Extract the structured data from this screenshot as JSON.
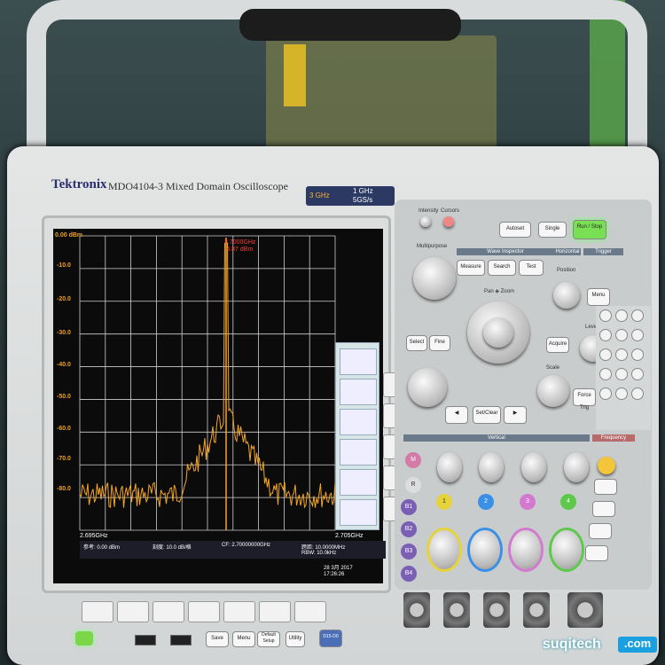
{
  "scene": {
    "brand": "Tektronix",
    "model": "MDO4104-3",
    "model_desc": "Mixed Domain Oscilloscope",
    "badge": {
      "freq": "3 GHz",
      "bw": "1 GHz",
      "sr": "5GS/s"
    }
  },
  "screen": {
    "ref_level": "0.00 dBm",
    "y_labels": [
      "-10.0",
      "-20.0",
      "-30.0",
      "-40.0",
      "-50.0",
      "-60.0",
      "-70.0",
      "-80.0"
    ],
    "marker": {
      "freq": "2.7000GHz",
      "level": "-4.87 dBm"
    },
    "x_start": "2.695GHz",
    "x_end": "2.705GHz",
    "status": {
      "ref": "参考: 0.00 dBm",
      "scale": "刻度: 10.0 dB/格",
      "cf": "CF: 2.70000000GHz",
      "span": "跨距: 10.0000MHz",
      "rbw": "RBW: 10.0kHz"
    },
    "date": "28 3月 2017",
    "time": "17:26:26",
    "colors": {
      "trace": "#f5a623",
      "grid": "#cfcfcf",
      "marker": "#ff3b3b",
      "bg": "#0b0b0b"
    }
  },
  "panel": {
    "top_labels": {
      "intensity": "Intensity",
      "cursors": "Cursors",
      "multipurpose": "Multipurpose"
    },
    "wave_inspector": "Wave Inspector",
    "horizontal": "Horizontal",
    "trigger": "Trigger",
    "vertical": "Vertical",
    "frequency": "Frequency",
    "buttons": {
      "autoset": "Autoset",
      "single": "Single",
      "runstop": "Run / Stop",
      "measure": "Measure",
      "search": "Search",
      "test": "Test",
      "select": "Select",
      "fine": "Fine",
      "setclear": "Set/Clear",
      "menu": "Menu",
      "acquire": "Acquire",
      "force": "Force Trig",
      "position": "Position",
      "level": "Level",
      "scale": "Scale",
      "pan_zoom": "Pan ◈ Zoom",
      "math": "M",
      "ref": "R",
      "b1": "B1",
      "b2": "B2",
      "b3": "B3",
      "b4": "B4",
      "save": "Save",
      "menu2": "Menu",
      "default": "Default Setup",
      "utility": "Utility",
      "d1516": "D15-D0"
    },
    "channels": [
      "1",
      "2",
      "3",
      "4"
    ]
  },
  "watermark": {
    "text": "suqitech",
    "suffix": ".com"
  }
}
